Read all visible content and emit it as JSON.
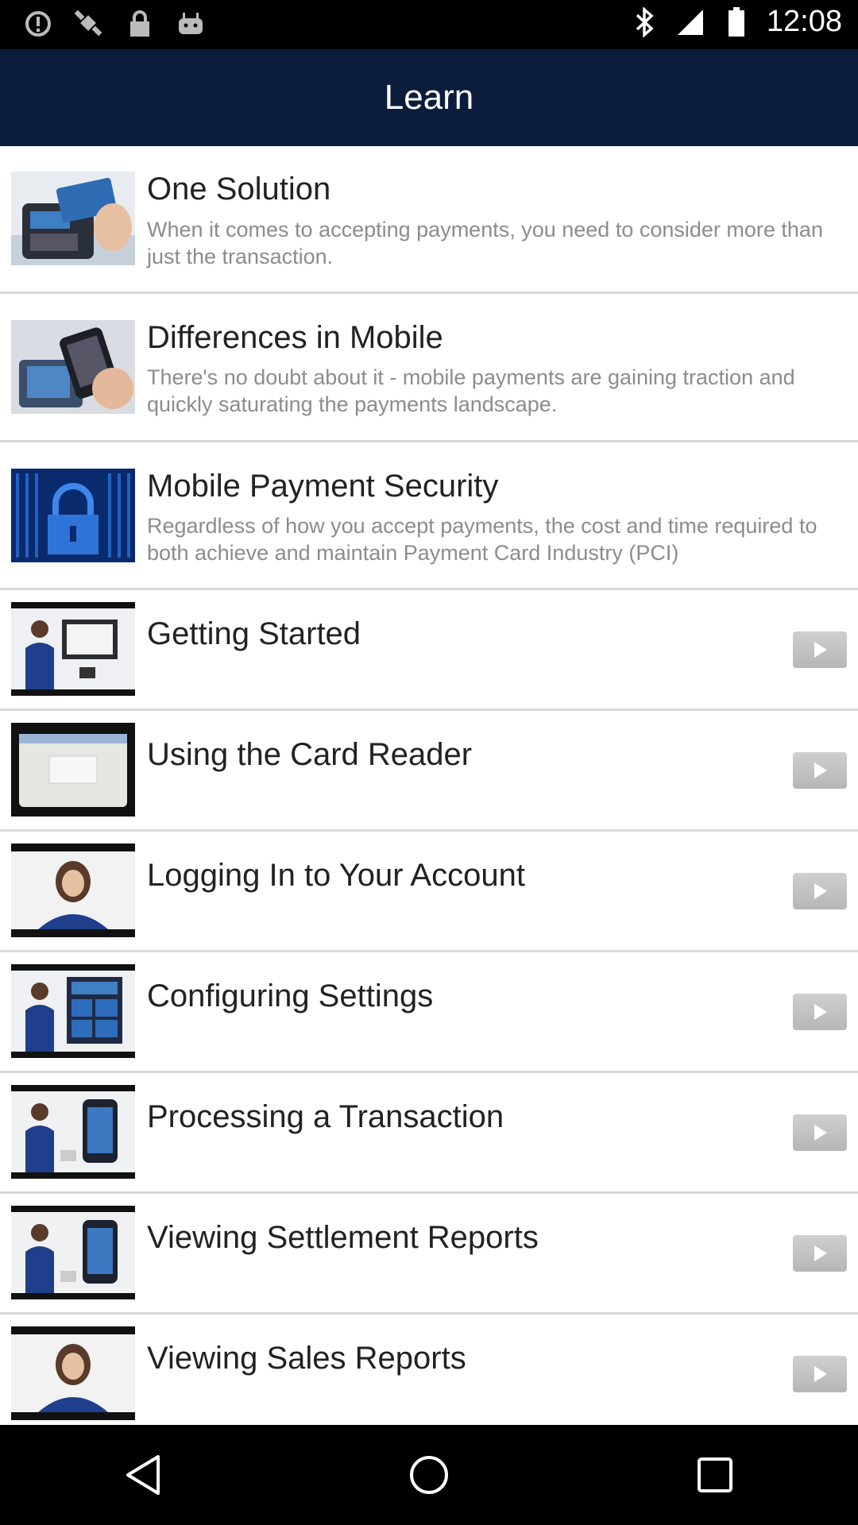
{
  "status": {
    "time": "12:08",
    "left_icons": [
      "alert-icon",
      "fake-gps-icon",
      "lock-icon",
      "android-icon"
    ],
    "right_icons": [
      "bluetooth-icon",
      "signal-icon",
      "battery-icon"
    ]
  },
  "header": {
    "title": "Learn"
  },
  "items": [
    {
      "title": "One Solution",
      "desc": "When it comes to accepting payments, you need to consider more than just the transaction."
    },
    {
      "title": "Differences in Mobile",
      "desc": "There's no doubt about it - mobile payments are gaining traction and quickly saturating the payments landscape."
    },
    {
      "title": "Mobile Payment Security",
      "desc": "Regardless of how you accept payments, the cost and time required to both achieve and maintain Payment Card Industry (PCI)"
    },
    {
      "title": "Getting Started"
    },
    {
      "title": "Using the Card Reader"
    },
    {
      "title": "Logging In to Your Account"
    },
    {
      "title": "Configuring Settings"
    },
    {
      "title": "Processing a Transaction"
    },
    {
      "title": "Viewing Settlement Reports"
    },
    {
      "title": "Viewing Sales Reports"
    }
  ],
  "nav": {
    "icons": [
      "back-icon",
      "home-icon",
      "recents-icon"
    ]
  }
}
